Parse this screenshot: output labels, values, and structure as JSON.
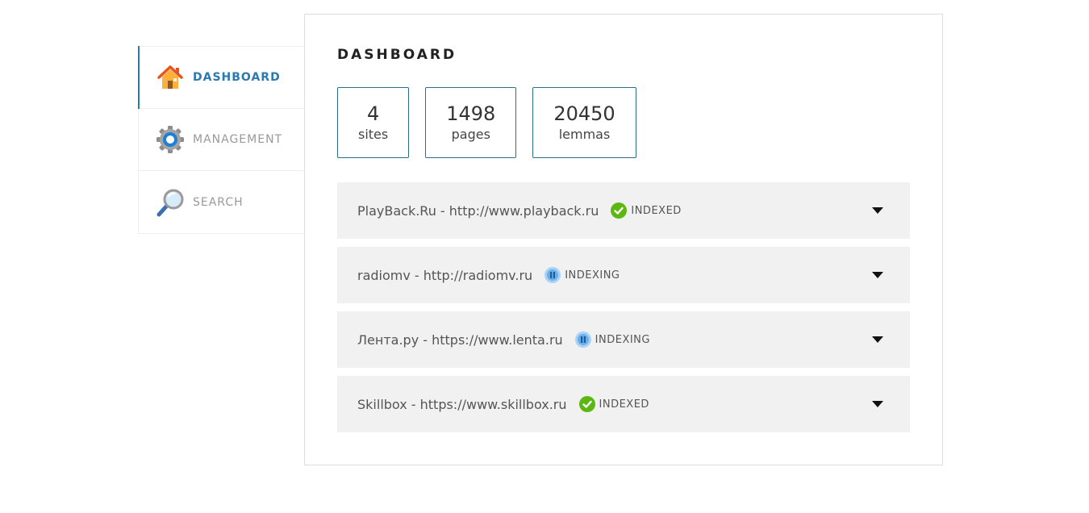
{
  "sidebar": {
    "items": [
      {
        "label": "DASHBOARD",
        "icon": "home-icon",
        "active": true
      },
      {
        "label": "MANAGEMENT",
        "icon": "gear-icon",
        "active": false
      },
      {
        "label": "SEARCH",
        "icon": "magnifier-icon",
        "active": false
      }
    ]
  },
  "main": {
    "title": "DASHBOARD",
    "stats": [
      {
        "value": "4",
        "label": "sites"
      },
      {
        "value": "1498",
        "label": "pages"
      },
      {
        "value": "20450",
        "label": "lemmas"
      }
    ],
    "sites": [
      {
        "name": "PlayBack.Ru - http://www.playback.ru",
        "status": "INDEXED",
        "status_icon": "check-icon"
      },
      {
        "name": "radiomv - http://radiomv.ru",
        "status": "INDEXING",
        "status_icon": "pause-icon"
      },
      {
        "name": "Лента.ру - https://www.lenta.ru",
        "status": "INDEXING",
        "status_icon": "pause-icon"
      },
      {
        "name": "Skillbox - https://www.skillbox.ru",
        "status": "INDEXED",
        "status_icon": "check-icon"
      }
    ]
  },
  "colors": {
    "accent": "#2a7ab0",
    "stat_border": "#2a6f8a",
    "indexed": "#5cb811",
    "indexing": "#6aaeea",
    "row_bg": "#f1f1f1"
  }
}
